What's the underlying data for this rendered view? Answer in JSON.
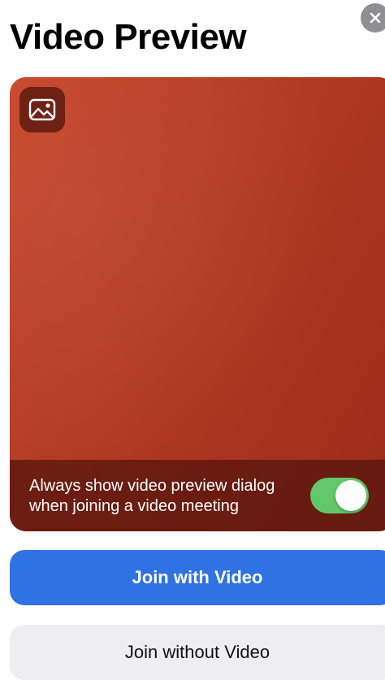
{
  "header": {
    "title": "Video Preview",
    "close_icon": "close-icon"
  },
  "preview": {
    "background_icon": "image-icon",
    "background_color": "#b23a22",
    "footer_text": "Always show video preview dialog when joining a video meeting",
    "toggle_on": true,
    "toggle_color": "#63c86b"
  },
  "actions": {
    "join_with_video": "Join with Video",
    "join_without_video": "Join without Video",
    "primary_color": "#2f72e3",
    "secondary_color": "#ededf2"
  }
}
